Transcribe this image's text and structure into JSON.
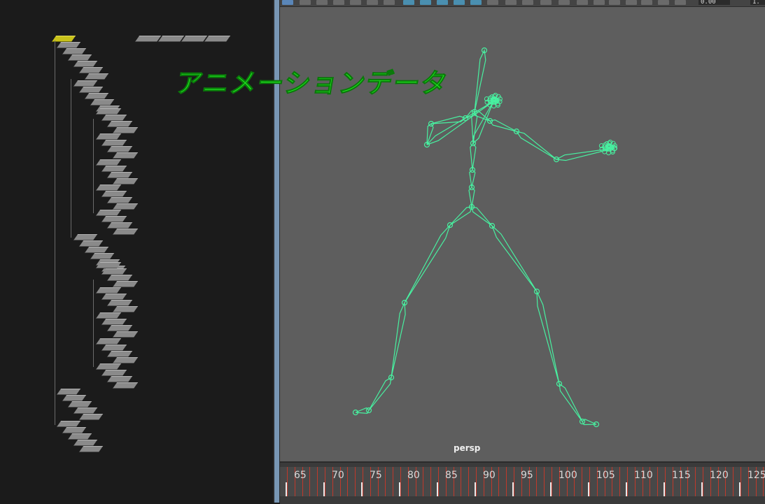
{
  "viewport": {
    "camera_label": "persp",
    "toolbar": {
      "field_value_1": "0.00",
      "field_value_2": "1."
    },
    "background_color": "#5e5e5e",
    "skeleton_color": "#48f0a0"
  },
  "overlay": {
    "caption": "アニメーションデータ",
    "color": "#22ee22"
  },
  "timeline": {
    "frame_labels": [
      "65",
      "70",
      "75",
      "80",
      "85",
      "90",
      "95",
      "100",
      "105",
      "110",
      "115",
      "120",
      "125"
    ],
    "tick_color": "#c0392b"
  },
  "node_editor": {
    "selected_color": "#c8c21a",
    "node_color": "#8a8a8a"
  }
}
